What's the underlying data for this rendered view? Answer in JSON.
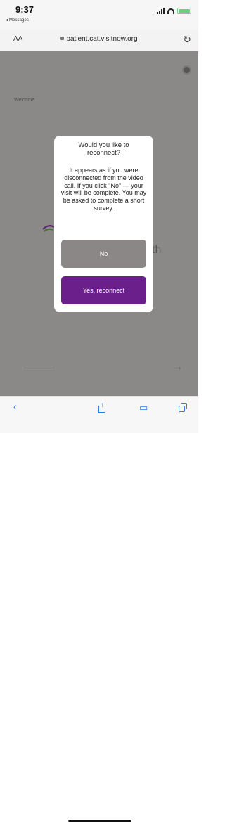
{
  "status_bar": {
    "time": "9:37",
    "back_app": "◂ Messages"
  },
  "url_bar": {
    "text_size_label": "AA",
    "url": "patient.cat.visitnow.org"
  },
  "background_page": {
    "welcome": "Welcome",
    "logo_partial": "th"
  },
  "modal": {
    "title": "Would you like to reconnect?",
    "body": "It appears as if you were disconnected from the video call. If you click \"No\" — your visit will be complete. You may be asked to complete a short survey.",
    "no_label": "No",
    "yes_label": "Yes, reconnect"
  },
  "colors": {
    "accent_purple": "#6a1f8a",
    "no_button_gray": "#8b8786",
    "page_overlay_gray": "#8a8988",
    "safari_blue": "#2f7ae5"
  },
  "toolbar": {
    "icons": [
      "back-icon",
      "share-icon",
      "bookmarks-icon",
      "tabs-icon"
    ]
  }
}
